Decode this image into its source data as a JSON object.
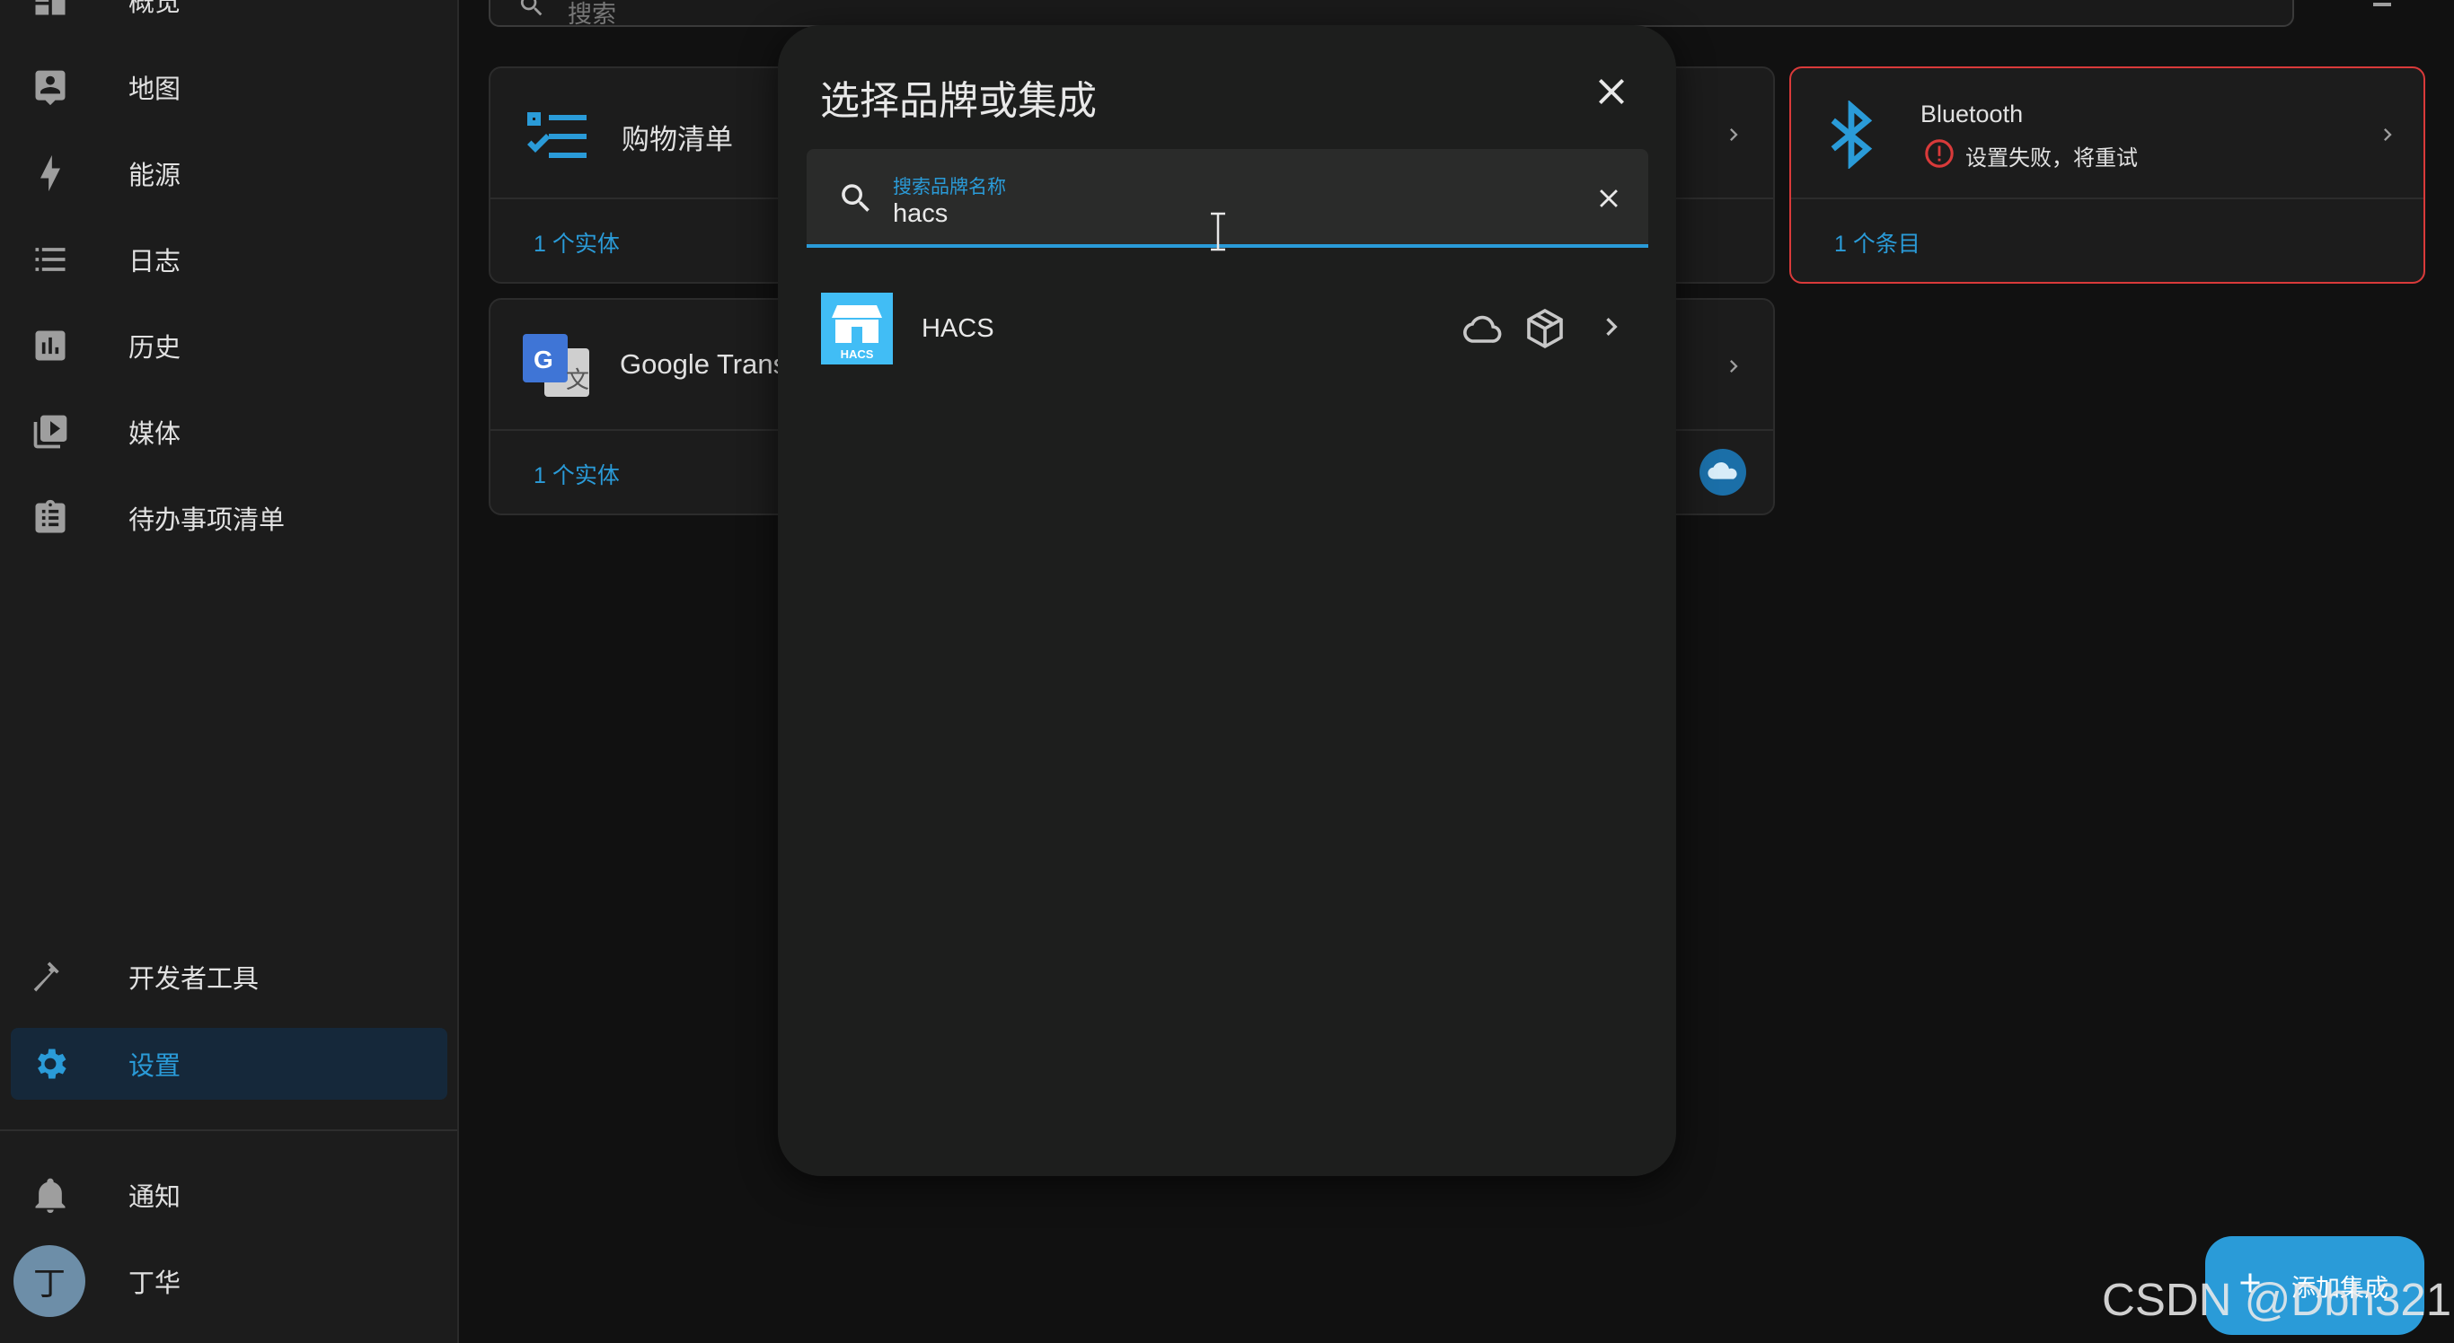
{
  "sidebar": {
    "items": [
      {
        "label": "概览",
        "icon": "dashboard-icon"
      },
      {
        "label": "地图",
        "icon": "map-account-icon"
      },
      {
        "label": "能源",
        "icon": "lightning-bolt-icon"
      },
      {
        "label": "日志",
        "icon": "format-list-icon"
      },
      {
        "label": "历史",
        "icon": "chart-box-icon"
      },
      {
        "label": "媒体",
        "icon": "play-box-multiple-icon"
      },
      {
        "label": "待办事项清单",
        "icon": "clipboard-list-icon"
      }
    ],
    "bottom_items": [
      {
        "label": "开发者工具",
        "icon": "hammer-icon"
      },
      {
        "label": "设置",
        "icon": "cog-icon",
        "active": true
      }
    ],
    "notifications_label": "通知",
    "user": {
      "initial": "丁",
      "name": "丁华"
    }
  },
  "main": {
    "search_placeholder": "搜索",
    "cards": {
      "shopping": {
        "title": "购物清单",
        "link": "1 个实体"
      },
      "google": {
        "title": "Google Translate",
        "link": "1 个实体"
      },
      "bluetooth": {
        "title": "Bluetooth",
        "status": "设置失败，将重试",
        "link": "1 个条目"
      }
    },
    "fab_label": "添加集成"
  },
  "dialog": {
    "title": "选择品牌或集成",
    "search_label": "搜索品牌名称",
    "search_value": "hacs",
    "results": [
      {
        "name": "HACS",
        "logo_text": "HACS"
      }
    ]
  },
  "watermark": "CSDN @Dbh321",
  "colors": {
    "accent": "#2a9bd8",
    "error": "#d93a3a",
    "hacs": "#41bdf5"
  }
}
